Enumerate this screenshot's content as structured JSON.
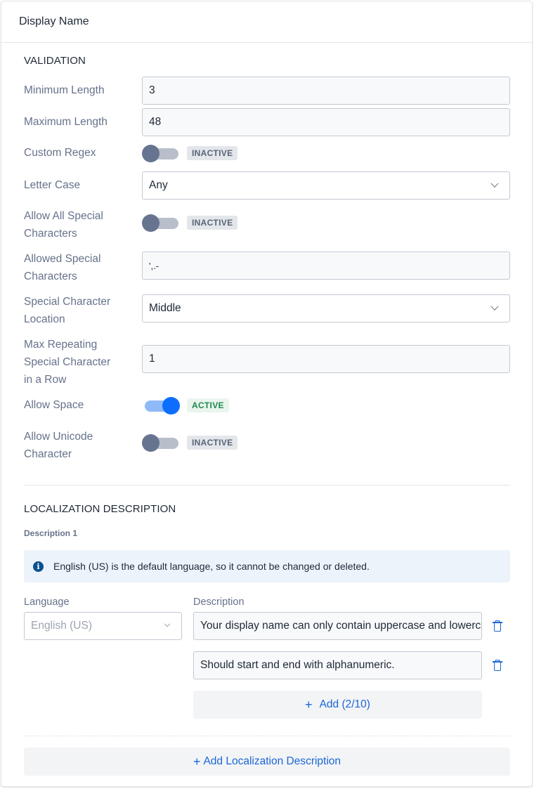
{
  "header": {
    "title": "Display Name"
  },
  "validation": {
    "title": "VALIDATION",
    "min_length": {
      "label": "Minimum Length",
      "value": "3"
    },
    "max_length": {
      "label": "Maximum Length",
      "value": "48"
    },
    "custom_regex": {
      "label": "Custom Regex",
      "state": "INACTIVE",
      "on": false
    },
    "letter_case": {
      "label": "Letter Case",
      "value": "Any"
    },
    "allow_all_special": {
      "label_line1": "Allow All Special",
      "label_line2": "Characters",
      "state": "INACTIVE",
      "on": false
    },
    "allowed_special": {
      "label_line1": "Allowed Special",
      "label_line2": "Characters",
      "value": "',.-"
    },
    "special_location": {
      "label_line1": "Special Character",
      "label_line2": "Location",
      "value": "Middle"
    },
    "max_repeating": {
      "label_line1": "Max Repeating",
      "label_line2": "Special Character",
      "label_line3": "in a Row",
      "value": "1"
    },
    "allow_space": {
      "label": "Allow Space",
      "state": "ACTIVE",
      "on": true
    },
    "allow_unicode": {
      "label_line1": "Allow Unicode",
      "label_line2": "Character",
      "state": "INACTIVE",
      "on": false
    }
  },
  "localization": {
    "title": "LOCALIZATION DESCRIPTION",
    "description_heading": "Description 1",
    "info_icon": "info-icon",
    "info_text": "English (US) is the default language, so it cannot be changed or deleted.",
    "language_label": "Language",
    "language_value": "English (US)",
    "description_label": "Description",
    "descriptions": [
      "Your display name can only contain uppercase and lowercase letters",
      "Should start and end with alphanumeric."
    ],
    "add_label": "Add (2/10)",
    "add_localization_label": "Add Localization Description",
    "colors": {
      "accent": "#1a66d6",
      "active_toggle": "#0d6efd",
      "active_badge": "#1a8a4a"
    }
  }
}
